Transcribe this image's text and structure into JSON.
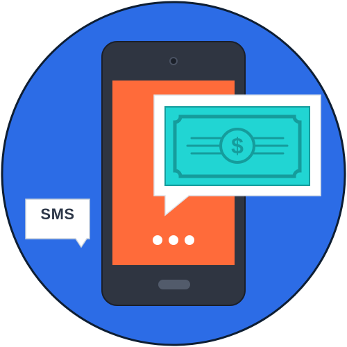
{
  "illustration": {
    "sms_label": "SMS",
    "money_symbol": "$",
    "icons": [
      "smartphone-icon",
      "speech-bubble-icon",
      "banknote-icon",
      "dollar-icon",
      "typing-dots-icon"
    ]
  },
  "colors": {
    "background_circle": "#2C6CE6",
    "circle_outline": "#0E1E33",
    "phone_body": "#2F3541",
    "phone_screen": "#FF6B3A",
    "bubble": "#FFFFFF",
    "banknote": "#21D5D3",
    "banknote_outline": "#159C9C",
    "text_dark": "#2D3748"
  }
}
